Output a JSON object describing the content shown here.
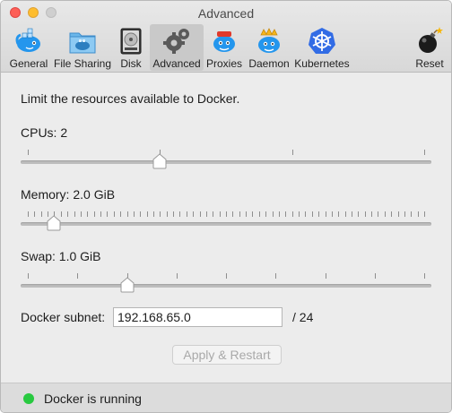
{
  "window": {
    "title": "Advanced"
  },
  "toolbar": {
    "items": [
      {
        "label": "General",
        "icon": "docker-whale-icon",
        "selected": false
      },
      {
        "label": "File Sharing",
        "icon": "folder-whale-icon",
        "selected": false
      },
      {
        "label": "Disk",
        "icon": "disk-icon",
        "selected": false
      },
      {
        "label": "Advanced",
        "icon": "gears-icon",
        "selected": true
      },
      {
        "label": "Proxies",
        "icon": "proxy-whale-icon",
        "selected": false
      },
      {
        "label": "Daemon",
        "icon": "daemon-whale-icon",
        "selected": false
      },
      {
        "label": "Kubernetes",
        "icon": "kubernetes-wheel-icon",
        "selected": false
      },
      {
        "label": "Reset",
        "icon": "bomb-icon",
        "selected": false
      }
    ]
  },
  "content": {
    "intro": "Limit the resources available to Docker.",
    "cpus": {
      "label": "CPUs: 2",
      "value": 2,
      "min": 1,
      "max": 4
    },
    "memory": {
      "label": "Memory: 2.0 GiB",
      "value": 2.0,
      "min": 1,
      "max": 16,
      "unit": "GiB"
    },
    "swap": {
      "label": "Swap: 1.0 GiB",
      "value": 1.0,
      "min": 0,
      "max": 4,
      "unit": "GiB"
    },
    "subnet": {
      "label": "Docker subnet:",
      "value": "192.168.65.0",
      "suffix": "/ 24"
    },
    "apply_label": "Apply & Restart"
  },
  "status": {
    "text": "Docker is running",
    "color": "#28c940"
  },
  "colors": {
    "docker_blue": "#2496ed",
    "selected_tab_bg": "#c9c9c9"
  }
}
